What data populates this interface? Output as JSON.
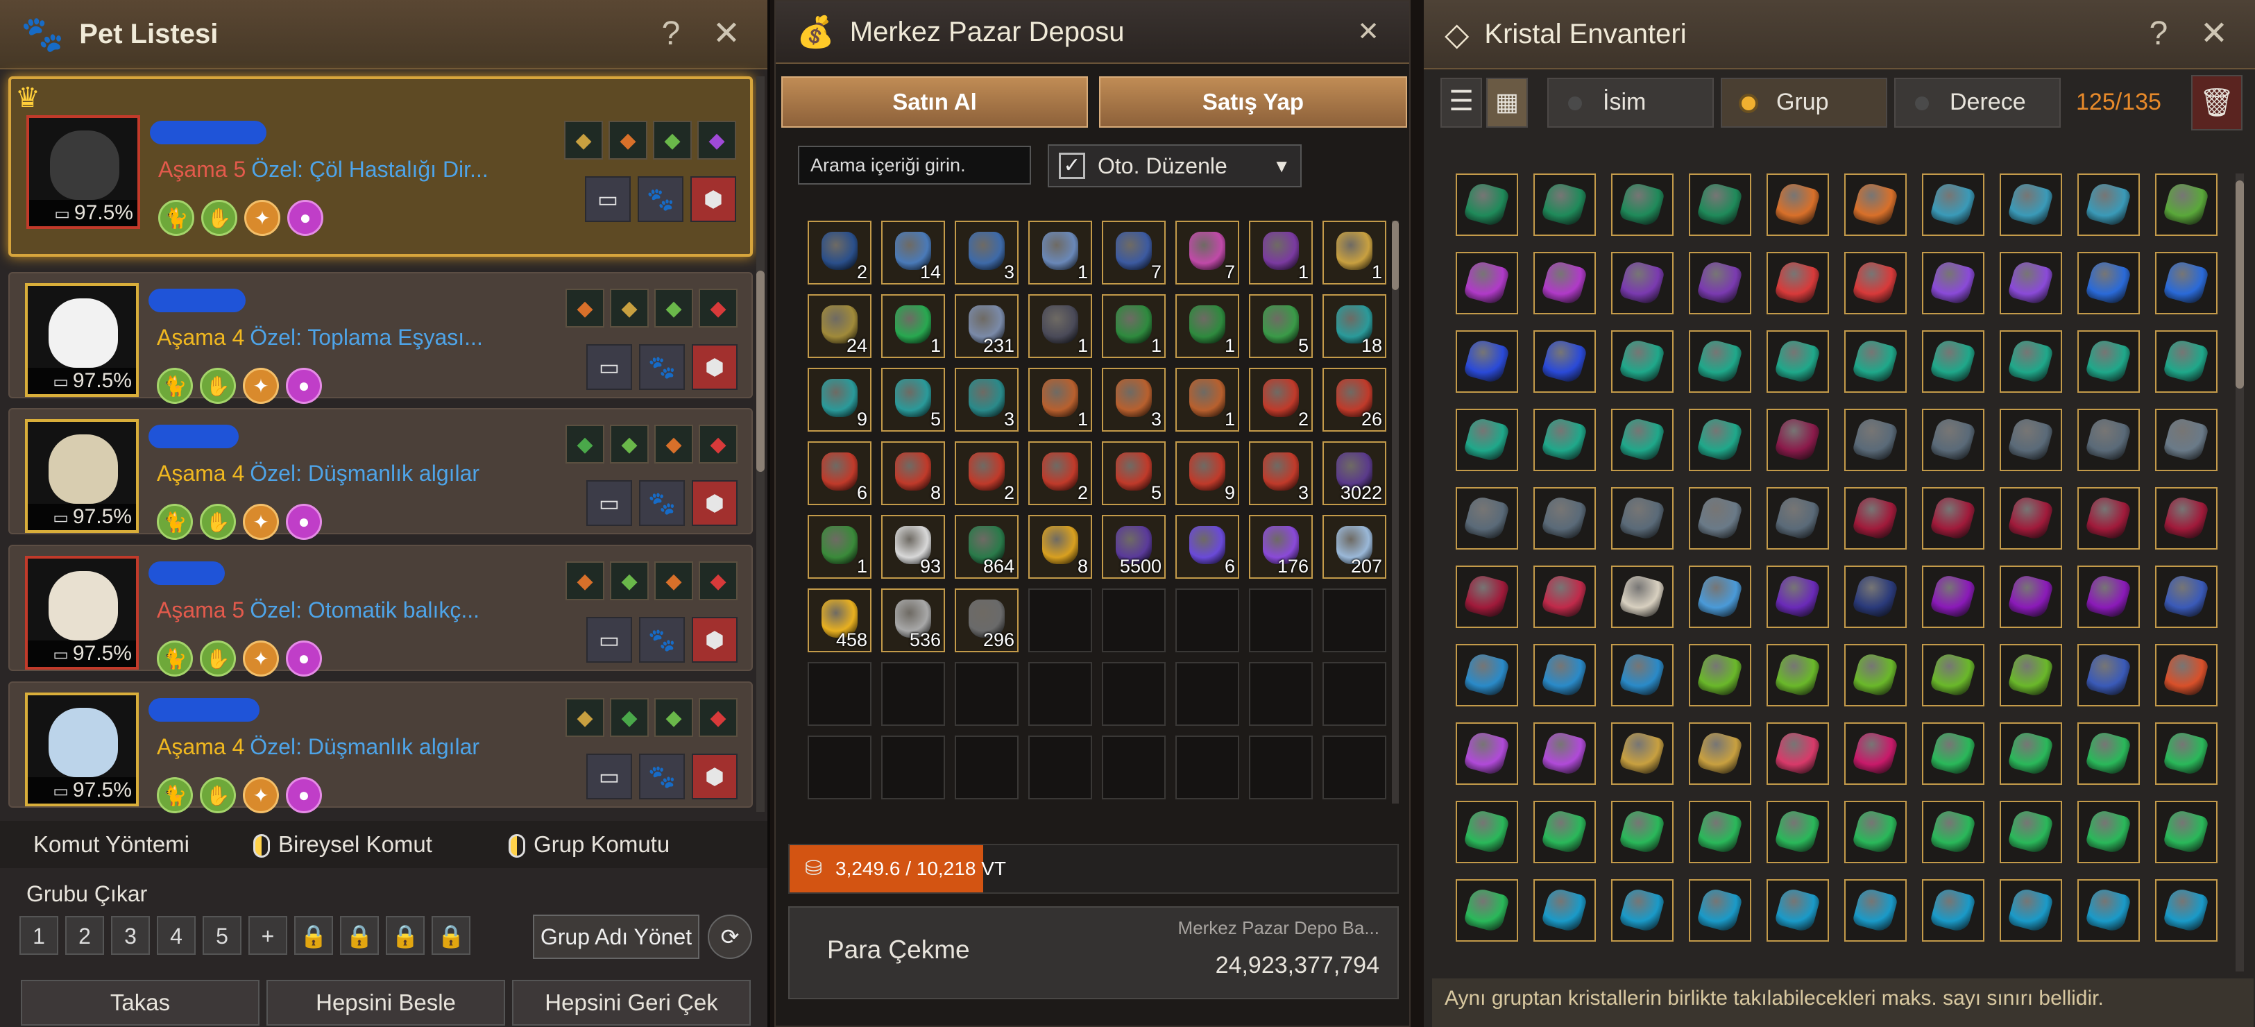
{
  "pet_panel": {
    "title": "Pet Listesi",
    "help_icon": "question-icon",
    "close_icon": "close-icon",
    "pets": [
      {
        "stage": "Aşama 5",
        "stage_color": "#e35a4c",
        "special": "Özel: Çöl Hastalığı Dir...",
        "percent": "97.5%",
        "selected": true,
        "silhouette_color": "#3a3a3a"
      },
      {
        "stage": "Aşama 4",
        "stage_color": "#f0b820",
        "special": "Özel: Toplama Eşyası...",
        "percent": "97.5%",
        "selected": false,
        "silhouette_color": "#f2f2f2"
      },
      {
        "stage": "Aşama 4",
        "stage_color": "#f0b820",
        "special": "Özel: Düşmanlık algılar",
        "percent": "97.5%",
        "selected": false,
        "silhouette_color": "#d8cdb0"
      },
      {
        "stage": "Aşama 5",
        "stage_color": "#e35a4c",
        "special": "Özel: Otomatik balıkç...",
        "percent": "97.5%",
        "selected": false,
        "silhouette_color": "#e8e0d0"
      },
      {
        "stage": "Aşama 4",
        "stage_color": "#f0b820",
        "special": "Özel: Düşmanlık algılar",
        "percent": "97.5%",
        "selected": false,
        "silhouette_color": "#bcd4ea"
      }
    ],
    "command_row": {
      "method": "Komut Yöntemi",
      "individual": "Bireysel Komut",
      "group": "Grup Komutu"
    },
    "group_title": "Grubu Çıkar",
    "group_slots": [
      "1",
      "2",
      "3",
      "4",
      "5"
    ],
    "group_name_button": "Grup Adı Yönet",
    "bottom_buttons": {
      "trade": "Takas",
      "feed_all": "Hepsini Besle",
      "recall_all": "Hepsini Geri Çek"
    }
  },
  "depot_panel": {
    "title": "Merkez Pazar Deposu",
    "buy": "Satın Al",
    "sell": "Satış Yap",
    "search_placeholder": "Arama içeriği girin.",
    "auto_sort": "Oto. Düzenle",
    "items": [
      {
        "count": "2",
        "color": "#2a4f8a"
      },
      {
        "count": "14",
        "color": "#4a7ab8"
      },
      {
        "count": "3",
        "color": "#3e6aa8"
      },
      {
        "count": "1",
        "color": "#6a88b8"
      },
      {
        "count": "7",
        "color": "#3c5aa0"
      },
      {
        "count": "7",
        "color": "#c04aa8"
      },
      {
        "count": "1",
        "color": "#7a3aa0"
      },
      {
        "count": "1",
        "color": "#c8a040"
      },
      {
        "count": "24",
        "color": "#a08a3a"
      },
      {
        "count": "1",
        "color": "#28a850"
      },
      {
        "count": "231",
        "color": "#7a8aa8"
      },
      {
        "count": "1",
        "color": "#4a4a58"
      },
      {
        "count": "1",
        "color": "#2e8a3e"
      },
      {
        "count": "1",
        "color": "#2e8a3e"
      },
      {
        "count": "5",
        "color": "#3a9a48"
      },
      {
        "count": "18",
        "color": "#2a9a9a"
      },
      {
        "count": "9",
        "color": "#2a9a9a"
      },
      {
        "count": "5",
        "color": "#2a9a9a"
      },
      {
        "count": "3",
        "color": "#2a8a8a"
      },
      {
        "count": "1",
        "color": "#b8602e"
      },
      {
        "count": "3",
        "color": "#b8602e"
      },
      {
        "count": "1",
        "color": "#b8602e"
      },
      {
        "count": "2",
        "color": "#c03a2a"
      },
      {
        "count": "26",
        "color": "#c03a2a"
      },
      {
        "count": "6",
        "color": "#c03a2a"
      },
      {
        "count": "8",
        "color": "#c03a2a"
      },
      {
        "count": "2",
        "color": "#c03a2a"
      },
      {
        "count": "2",
        "color": "#c03a2a"
      },
      {
        "count": "5",
        "color": "#c03a2a"
      },
      {
        "count": "9",
        "color": "#c03a2a"
      },
      {
        "count": "3",
        "color": "#c03a2a"
      },
      {
        "count": "3022",
        "color": "#5a3a8a"
      },
      {
        "count": "1",
        "color": "#3a8a3a"
      },
      {
        "count": "93",
        "color": "#d8d8d8"
      },
      {
        "count": "864",
        "color": "#2a7a4a"
      },
      {
        "count": "8",
        "color": "#d8a020"
      },
      {
        "count": "5500",
        "color": "#5a3a9a"
      },
      {
        "count": "6",
        "color": "#6a4ad8"
      },
      {
        "count": "176",
        "color": "#8a4ad8"
      },
      {
        "count": "207",
        "color": "#9ab8d8"
      },
      {
        "count": "458",
        "color": "#e8b020"
      },
      {
        "count": "536",
        "color": "#a8a8a8"
      },
      {
        "count": "296",
        "color": "#6a6a6a"
      }
    ],
    "capacity": "3,249.6 / 10,218",
    "capacity_unit": "VT",
    "capacity_fraction": 0.318,
    "withdraw": "Para Çekme",
    "balance_label": "Merkez Pazar Depo Ba...",
    "balance": "24,923,377,794"
  },
  "crystal_panel": {
    "title": "Kristal Envanteri",
    "sort_name": "İsim",
    "sort_group": "Grup",
    "sort_grade": "Derece",
    "count_current": "125",
    "count_max": "/135",
    "note": "Aynı gruptan kristallerin birlikte takılabilecekleri maks. sayı sınırı bellidir.",
    "rows": [
      [
        "#1f8a5a",
        "#1f8a5a",
        "#1f8a5a",
        "#1f8a5a",
        "#d8702a",
        "#d8702a",
        "#3a9ab8",
        "#3a9ab8",
        "#3a9ab8",
        "#5aa83a"
      ],
      [
        "#b03ac8",
        "#b03ac8",
        "#7a3ab0",
        "#7a3ab0",
        "#d83a3a",
        "#d83a3a",
        "#8a4ad8",
        "#8a4ad8",
        "#2a6ad8",
        "#2a6ad8"
      ],
      [
        "#2a4ad8",
        "#2a4ad8",
        "#1fa88a",
        "#1fa88a",
        "#1fa88a",
        "#1fa88a",
        "#1fa88a",
        "#1fa88a",
        "#1fa88a",
        "#1fa88a"
      ],
      [
        "#1fa88a",
        "#1fa88a",
        "#1fa88a",
        "#1fa88a",
        "#8a1a4a",
        "#5a6a78",
        "#5a6a78",
        "#5a6a78",
        "#5a6a78",
        "#6a7a88"
      ],
      [
        "#5a6a78",
        "#5a6a78",
        "#5a6a78",
        "#6a7a88",
        "#5a6a78",
        "#a01a3a",
        "#a01a3a",
        "#a01a3a",
        "#a01a3a",
        "#a01a3a"
      ],
      [
        "#a01a3a",
        "#c02a4a",
        "#d8d0c0",
        "#4a9ad8",
        "#6a2ab8",
        "#2a3a7a",
        "#8a1ab8",
        "#8a1ab8",
        "#8a1ab8",
        "#3a5ab8"
      ],
      [
        "#2a8ac8",
        "#2a8ac8",
        "#2a8ac8",
        "#6ab82a",
        "#6ab82a",
        "#6ab82a",
        "#6ab82a",
        "#6ab82a",
        "#3a5ab8",
        "#d8502a"
      ],
      [
        "#b04ad8",
        "#b04ad8",
        "#c8a040",
        "#c8a040",
        "#d83a6a",
        "#c81a6a",
        "#2ab85a",
        "#2ab85a",
        "#2ab85a",
        "#2ab85a"
      ],
      [
        "#2ab85a",
        "#2ab85a",
        "#2ab85a",
        "#2ab85a",
        "#2ab85a",
        "#2ab85a",
        "#2ab85a",
        "#2ab85a",
        "#2ab85a",
        "#2ab85a"
      ],
      [
        "#2ab85a",
        "#1a9ac8",
        "#1a9ac8",
        "#1a9ac8",
        "#1a9ac8",
        "#1a9ac8",
        "#1a9ac8",
        "#1a9ac8",
        "#1a9ac8",
        "#1a9ac8"
      ]
    ]
  }
}
